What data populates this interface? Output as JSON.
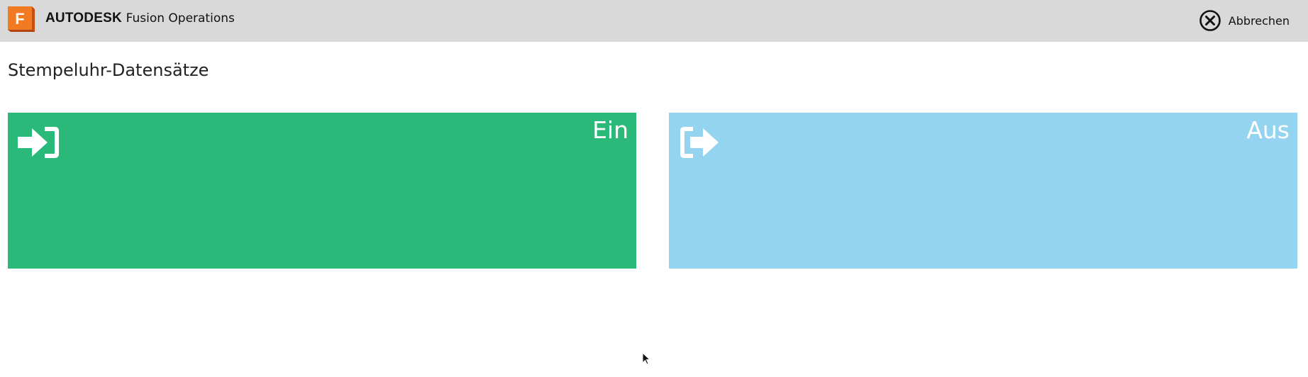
{
  "header": {
    "brand_strong": "AUTODESK",
    "brand_product": "Fusion Operations",
    "logo_letter": "F",
    "logo_icon": "autodesk-fusion-logo-icon",
    "cancel_label": "Abbrechen",
    "cancel_icon": "close-circle-icon"
  },
  "page": {
    "title": "Stempeluhr-Datensätze"
  },
  "tiles": [
    {
      "label": "Ein",
      "icon": "sign-in-icon",
      "color": "#2ab978"
    },
    {
      "label": "Aus",
      "icon": "sign-out-icon",
      "color": "#95d4f0"
    }
  ],
  "colors": {
    "topbar": "#d9d9d9",
    "logo_orange": "#ef6c1a"
  }
}
